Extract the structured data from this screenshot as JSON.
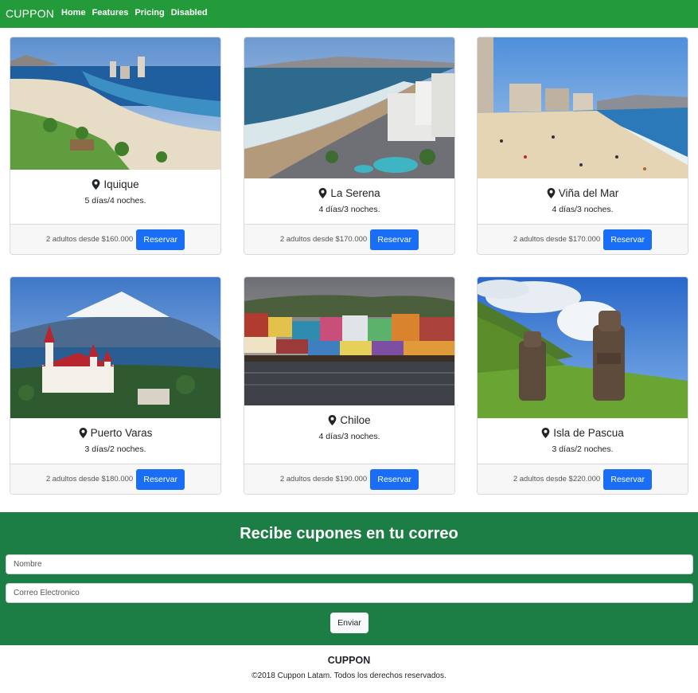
{
  "navbar": {
    "brand": "CUPPON",
    "links": [
      "Home",
      "Features",
      "Pricing",
      "Disabled"
    ]
  },
  "cards": [
    {
      "title": "Iquique",
      "duration": "5 días/4 noches.",
      "price_text": "2 adultos desde $160.000",
      "button": "Reservar"
    },
    {
      "title": "La Serena",
      "duration": "4 días/3 noches.",
      "price_text": "2 adultos desde $170.000",
      "button": "Reservar"
    },
    {
      "title": "Viña del Mar",
      "duration": "4 días/3 noches.",
      "price_text": "2 adultos desde $170.000",
      "button": "Reservar"
    },
    {
      "title": "Puerto Varas",
      "duration": "3 días/2 noches.",
      "price_text": "2 adultos desde $180.000",
      "button": "Reservar"
    },
    {
      "title": "Chiloe",
      "duration": "4 días/3 noches.",
      "price_text": "2 adultos desde $190.000",
      "button": "Reservar"
    },
    {
      "title": "Isla de Pascua",
      "duration": "3 días/2 noches.",
      "price_text": "2 adultos desde $220.000",
      "button": "Reservar"
    }
  ],
  "newsletter": {
    "title": "Recibe cupones en tu correo",
    "name_placeholder": "Nombre",
    "email_placeholder": "Correo Electronico",
    "submit": "Enviar"
  },
  "footer": {
    "brand": "CUPPON",
    "copyright": "©2018 Cuppon Latam. Todos los derechos reservados."
  },
  "colors": {
    "navbar": "#239b3a",
    "newsletter": "#1c7e44",
    "button_primary": "#1a6ef5"
  },
  "icons": {
    "location": "map-marker-icon"
  }
}
